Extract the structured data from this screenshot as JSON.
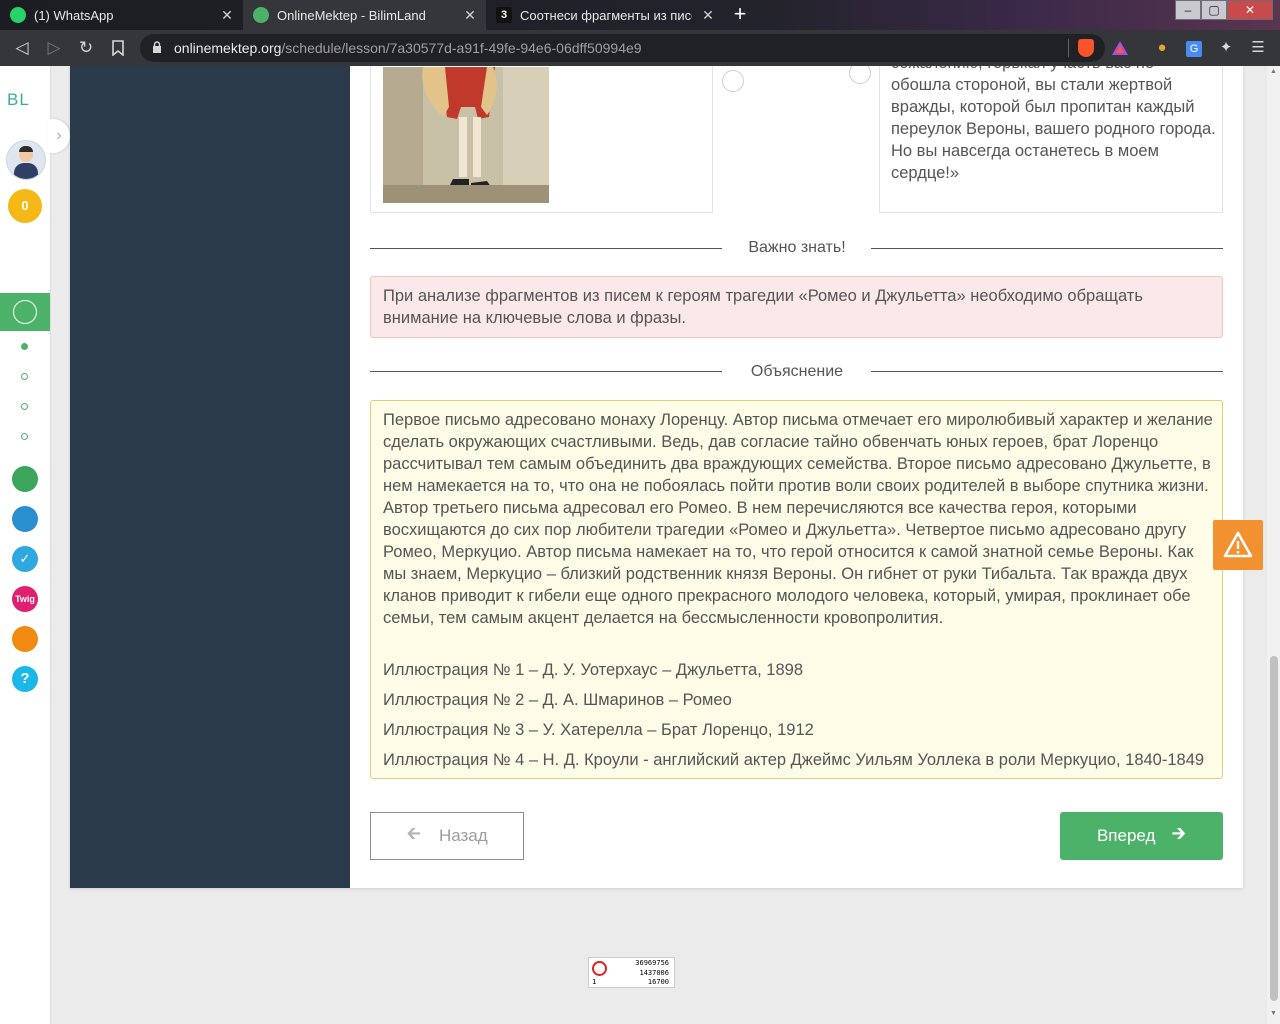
{
  "browser": {
    "tabs": [
      {
        "title": "(1) WhatsApp",
        "icon": "whatsapp-icon",
        "color": "#25d366"
      },
      {
        "title": "OnlineMektep - BilimLand",
        "icon": "bilimland-icon",
        "color": "#4db269",
        "active": true
      },
      {
        "title": "Соотнеси фрагменты из писем к",
        "icon": "z-icon",
        "color": "#111111"
      }
    ],
    "url_host": "onlinemektep.org",
    "url_path": "/schedule/lesson/7a30577d-a91f-49fe-94e6-06dff50994e9"
  },
  "sidebar": {
    "logo": "BL",
    "points": "0",
    "icons": [
      "online-mektep-icon",
      "bilimland-icon",
      "bilimbook-icon",
      "check-icon",
      "twig-icon",
      "idealogy-icon",
      "help-icon"
    ],
    "help_label": "?",
    "twig_label": "Twig"
  },
  "lesson": {
    "letter_fragment": "сожалению, горькая участь вас не обошла стороной, вы стали жертвой вражды, которой был пропитан каждый переулок Вероны, вашего родного города. Но вы навсегда останетесь в моем сердце!»",
    "important_title": "Важно знать!",
    "important_text": "При анализе фрагментов из писем к героям трагедии «Ромео и Джульетта» необходимо обращать внимание на ключевые слова и фразы.",
    "explanation_title": "Объяснение",
    "explanation_text": "Первое письмо адресовано монаху Лоренцу. Автор письма отмечает его миролюбивый характер и желание сделать окружающих счастливыми. Ведь, дав согласие тайно обвенчать юных героев, брат Лоренцо рассчитывал тем самым объединить два враждующих семейства. Второе письмо адресовано Джульетте, в нем намекается на то, что она не побоялась пойти против воли своих родителей в выборе спутника жизни. Автор третьего письма адресовал его Ромео. В нем перечисляются все качества героя, которыми восхищаются до сих пор любители трагедии «Ромео и Джульетта». Четвертое письмо адресовано другу Ромео, Меркуцио. Автор письма намекает на то, что герой относится к самой знатной семье Вероны. Как мы знаем, Меркуцио – близкий родственник князя Вероны. Он гибнет от руки Тибальта. Так вражда двух кланов приводит к гибели еще одного прекрасного молодого человека, который, умирая, проклинает обе семьи, тем самым акцент делается на бессмысленности кровопролития.",
    "illustrations": [
      "Иллюстрация № 1 – Д. У. Уотерхаус – Джульетта, 1898",
      "Иллюстрация № 2 – Д. А. Шмаринов – Ромео",
      "Иллюстрация № 3 – У. Хатерелла – Брат Лоренцо, 1912",
      "Иллюстрация № 4 – Н. Д. Кроули - английский актер Джеймс Уильям Уоллека в роли Меркуцио, 1840-1849"
    ],
    "back_label": "Назад",
    "forward_label": "Вперед"
  },
  "counter": {
    "line1": "36969756",
    "line2": "1437006",
    "line3": "16700",
    "left": "1"
  },
  "colors": {
    "accent": "#4db269",
    "warning": "#f2912f",
    "important_bg": "#fbe9e9",
    "explanation_bg": "#fdfce6"
  }
}
